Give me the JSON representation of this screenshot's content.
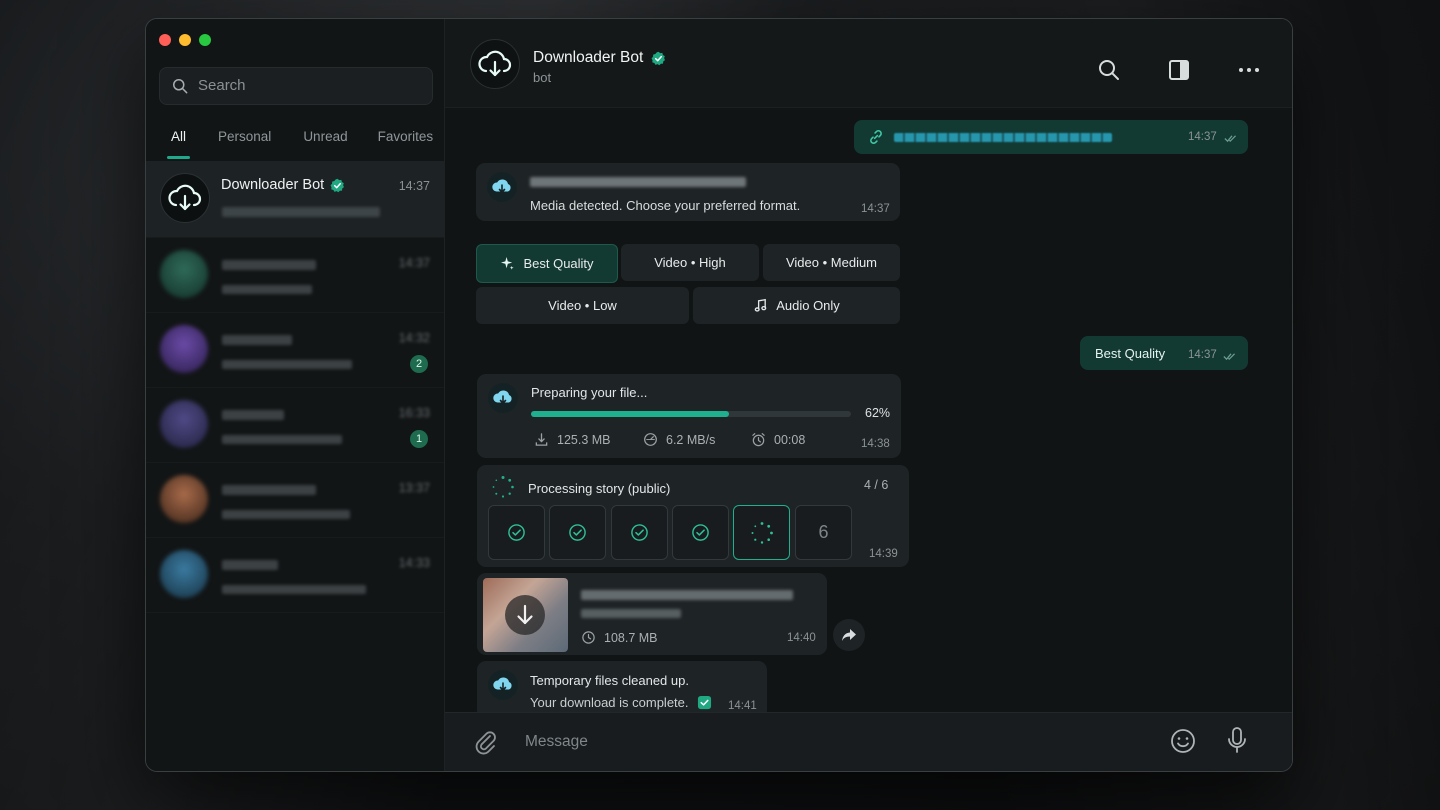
{
  "sidebar": {
    "search": {
      "placeholder": "Search"
    },
    "filters": [
      {
        "label": "All",
        "active": true
      },
      {
        "label": "Personal",
        "active": false
      },
      {
        "label": "Unread",
        "active": false
      },
      {
        "label": "Favorites",
        "active": false
      }
    ],
    "chats": [
      {
        "name": "Downloader Bot",
        "time": "14:37",
        "active": true
      },
      {
        "name": "",
        "time": "14:37",
        "badge": ""
      },
      {
        "name": "",
        "time": "14:32",
        "badge": "2"
      },
      {
        "name": "",
        "time": "16:33",
        "badge": "1"
      },
      {
        "name": "",
        "time": "13:37",
        "badge": ""
      },
      {
        "name": "",
        "time": "14:33",
        "badge": ""
      }
    ]
  },
  "header": {
    "title": "Downloader Bot",
    "subtitle": "bot"
  },
  "messages": {
    "link_msg": {
      "time": "14:37"
    },
    "media_msg": {
      "text": "Media detected. Choose your preferred format.",
      "time": "14:37"
    },
    "options": {
      "best": "Best Quality",
      "high": "Video • High",
      "medium": "Video • Medium",
      "low": "Video • Low",
      "audio": "Audio Only"
    },
    "reply": {
      "text": "Best Quality",
      "time": "14:37"
    },
    "progress": {
      "title": "Preparing your file...",
      "percent_label": "62%",
      "percent": 62,
      "size": "125.3 MB",
      "speed": "6.2 MB/s",
      "eta": "00:08",
      "time": "14:38"
    },
    "processing": {
      "title": "Processing story (public)",
      "count": "4 / 6",
      "last_step": "6",
      "time": "14:39"
    },
    "file": {
      "size": "108.7 MB",
      "time": "14:40"
    },
    "complete": {
      "line1": "Temporary files cleaned up.",
      "line2": "Your download is complete.",
      "time": "14:41"
    }
  },
  "composer": {
    "placeholder": "Message"
  },
  "colors": {
    "accent": "#1fb08f",
    "bubble_out": "#123a33",
    "bubble_in": "#1e2325"
  }
}
